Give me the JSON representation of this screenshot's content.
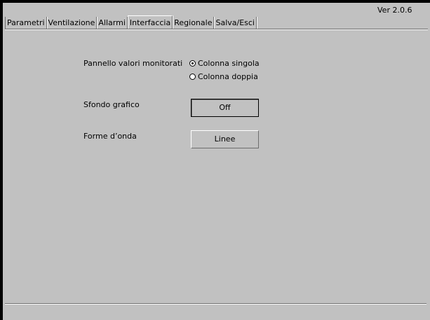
{
  "header": {
    "version": "Ver 2.0.6"
  },
  "tabs": [
    {
      "label": "Parametri",
      "active": false
    },
    {
      "label": "Ventilazione",
      "active": false
    },
    {
      "label": "Allarmi",
      "active": false
    },
    {
      "label": "Interfaccia",
      "active": true
    },
    {
      "label": "Regionale",
      "active": false
    },
    {
      "label": "Salva/Esci",
      "active": false
    }
  ],
  "settings": {
    "monitor_panel": {
      "label": "Pannello valori monitorati",
      "options": [
        {
          "label": "Colonna singola",
          "selected": true
        },
        {
          "label": "Colonna doppia",
          "selected": false
        }
      ]
    },
    "graph_background": {
      "label": "Sfondo grafico",
      "value": "Off"
    },
    "waveforms": {
      "label": "Forme d’onda",
      "value": "Linee"
    }
  }
}
